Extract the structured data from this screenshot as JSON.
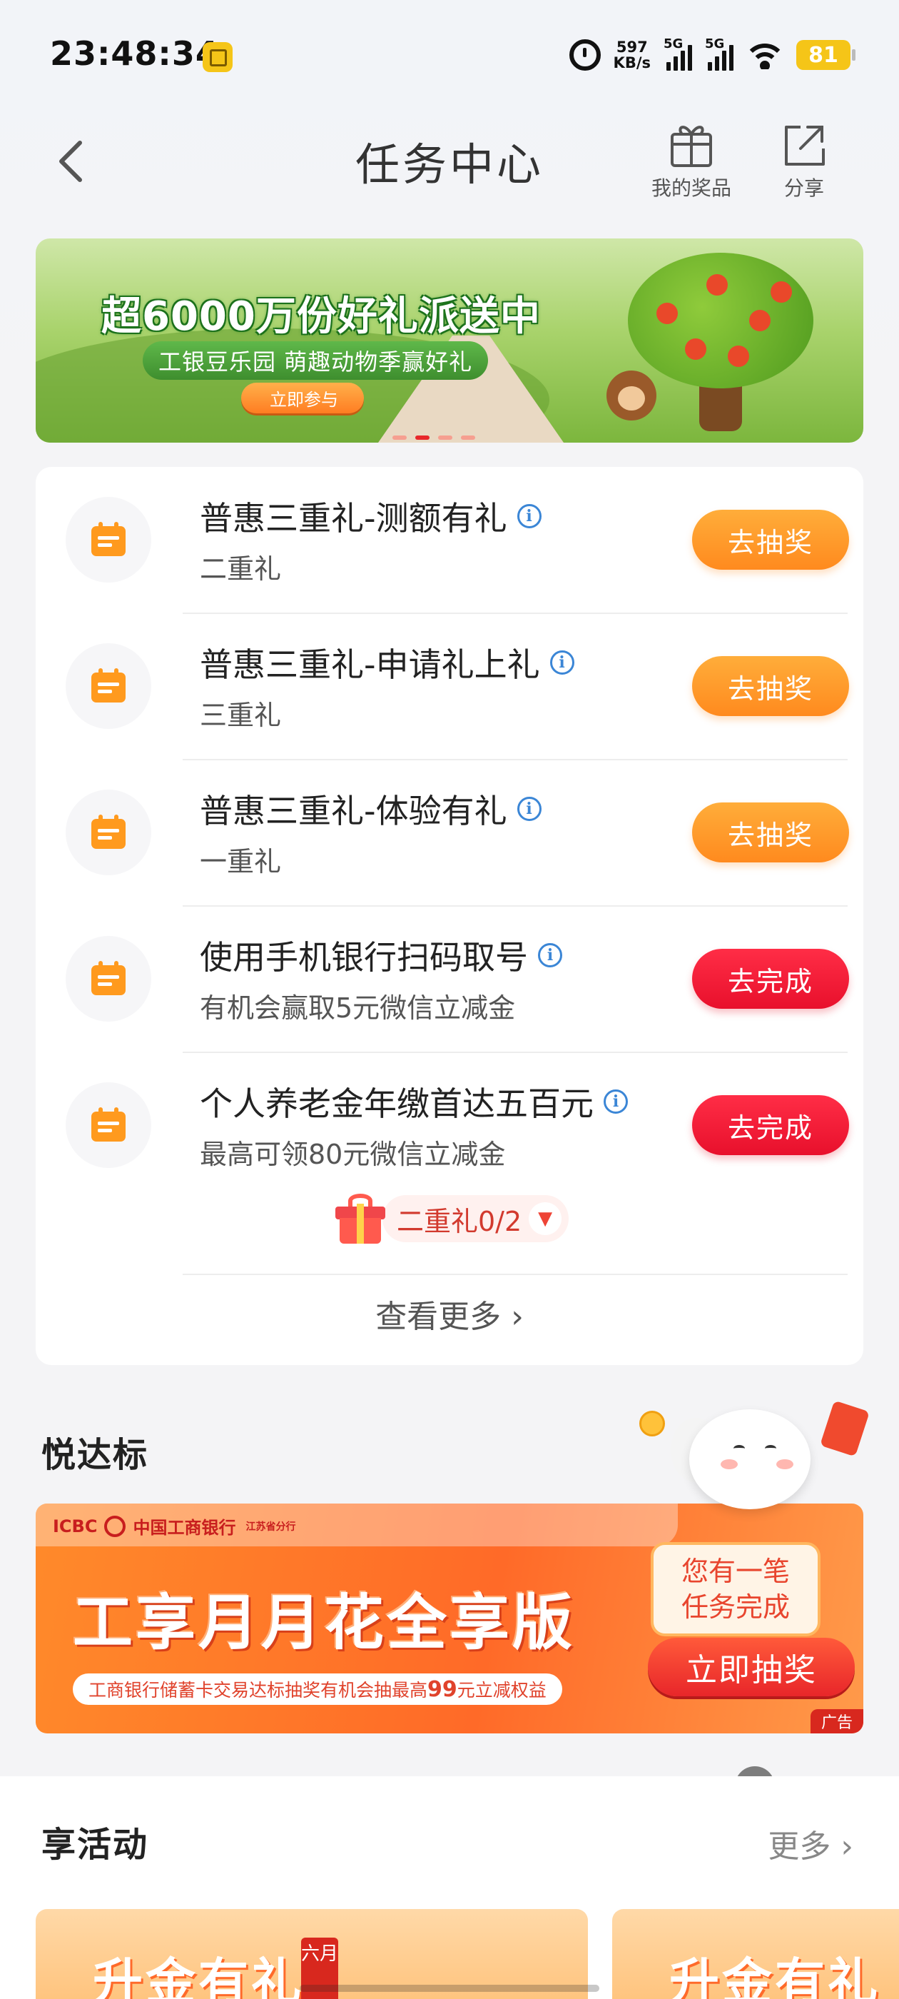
{
  "status_bar": {
    "time": "23:48:34",
    "net_speed_value": "597",
    "net_speed_unit": "KB/s",
    "signal_1": "5G",
    "signal_2": "5G",
    "battery": "81"
  },
  "nav": {
    "title": "任务中心",
    "my_prizes": "我的奖品",
    "share": "分享"
  },
  "top_banner": {
    "headline": "超6000万份好礼派送中",
    "subline": "工银豆乐园 萌趣动物季赢好礼",
    "cta": "立即参与",
    "pagination_count": 4,
    "active_page": 2
  },
  "tasks": [
    {
      "title": "普惠三重礼-测额有礼",
      "subtitle": "二重礼",
      "button": "去抽奖",
      "button_style": "orange"
    },
    {
      "title": "普惠三重礼-申请礼上礼",
      "subtitle": "三重礼",
      "button": "去抽奖",
      "button_style": "orange"
    },
    {
      "title": "普惠三重礼-体验有礼",
      "subtitle": "一重礼",
      "button": "去抽奖",
      "button_style": "orange"
    },
    {
      "title": "使用手机银行扫码取号",
      "subtitle": "有机会赢取5元微信立减金",
      "button": "去完成",
      "button_style": "red"
    },
    {
      "title": "个人养老金年缴首达五百元",
      "subtitle": "最高可领80元微信立减金",
      "button": "去完成",
      "button_style": "red"
    }
  ],
  "gift_progress": "二重礼0/2",
  "see_more": "查看更多",
  "yue_dabiao": {
    "title": "悦达标",
    "bank_name": "中国工商银行",
    "bank_abbr": "ICBC",
    "branch": "江苏省分行",
    "headline": "工享月月花全享版",
    "sub_before": "工商银行储蓄卡交易达标抽奖有机会抽最高",
    "sub_amount": "99",
    "sub_after": "元立减权益",
    "bubble_line1": "您有一笔",
    "bubble_line2": "任务完成",
    "cta": "立即抽奖",
    "ad_tag": "广告"
  },
  "activities": {
    "title": "享活动",
    "more": "更多",
    "cards": [
      {
        "text": "升金有礼",
        "month": "六月"
      },
      {
        "text": "升金有礼",
        "month": ""
      }
    ]
  },
  "colors": {
    "orange_button": "#ff9a2a",
    "red_button": "#ee1a34",
    "info_blue": "#3b86d6",
    "gift_red": "#d23a2e"
  }
}
